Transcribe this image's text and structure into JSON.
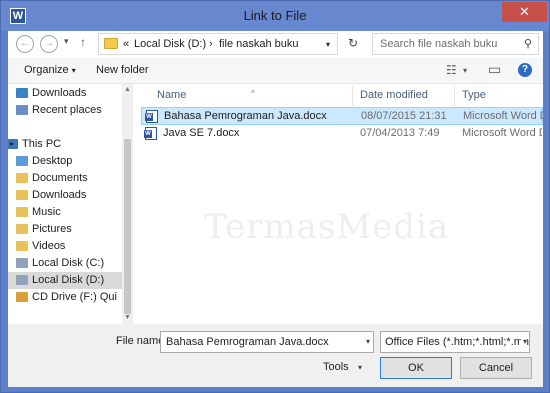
{
  "window": {
    "title": "Link to File",
    "app_icon": "word-icon",
    "close_glyph": "✕"
  },
  "navigation": {
    "back_glyph": "←",
    "forward_glyph": "→",
    "recent_glyph": "▾",
    "up_glyph": "↑",
    "address": {
      "prefix": "«",
      "segments": [
        "Local Disk (D:)",
        "file naskah buku"
      ],
      "separator": "›",
      "dropdown_glyph": "▾"
    },
    "refresh_glyph": "↻",
    "search": {
      "placeholder": "Search file naskah buku",
      "icon_glyph": "⚲"
    }
  },
  "toolbar": {
    "organize": "Organize",
    "organize_glyph": "▾",
    "new_folder": "New folder",
    "view_glyph": "☷",
    "view_drop_glyph": "▾",
    "pane_glyph": "▭",
    "help_glyph": "?"
  },
  "sidebar": {
    "items": [
      {
        "label": "Downloads",
        "icon": "downloads-icon",
        "color": "#3b82c4"
      },
      {
        "label": "Recent places",
        "icon": "recent-places-icon",
        "color": "#6b8fc2"
      },
      {
        "label": "This PC",
        "icon": "computer-icon",
        "color": "#3b76b8"
      },
      {
        "label": "Desktop",
        "icon": "desktop-icon",
        "color": "#5a9bd8"
      },
      {
        "label": "Documents",
        "icon": "documents-icon",
        "color": "#e8c15a"
      },
      {
        "label": "Downloads",
        "icon": "downloads-icon",
        "color": "#e8c15a"
      },
      {
        "label": "Music",
        "icon": "music-icon",
        "color": "#e8c15a"
      },
      {
        "label": "Pictures",
        "icon": "pictures-icon",
        "color": "#e8c15a"
      },
      {
        "label": "Videos",
        "icon": "videos-icon",
        "color": "#e8c15a"
      },
      {
        "label": "Local Disk (C:)",
        "icon": "drive-c-icon",
        "color": "#8fa3b8"
      },
      {
        "label": "Local Disk (D:)",
        "icon": "drive-d-icon",
        "color": "#8fa3b8",
        "selected": true
      },
      {
        "label": "CD Drive (F:) Qui",
        "icon": "cd-drive-icon",
        "color": "#d9a03a"
      }
    ]
  },
  "files": {
    "columns": {
      "name": "Name",
      "date": "Date modified",
      "type": "Type",
      "sort_glyph": "^"
    },
    "rows": [
      {
        "name": "Bahasa Pemrograman Java.docx",
        "date": "08/07/2015 21:31",
        "type": "Microsoft Word D...",
        "selected": true
      },
      {
        "name": "Java SE 7.docx",
        "date": "07/04/2013 7:49",
        "type": "Microsoft Word D..."
      }
    ]
  },
  "watermark": "TermasMedia",
  "footer": {
    "file_name_label": "File name:",
    "file_name_value": "Bahasa Pemrograman Java.docx",
    "dropdown_glyph": "▾",
    "filter_value": "Office Files (*.htm;*.html;*.mht",
    "tools": "Tools",
    "ok": "OK",
    "cancel": "Cancel"
  },
  "colors": {
    "titlebar": "#6787cf",
    "selection": "#cce8ff",
    "close": "#c7504b"
  }
}
